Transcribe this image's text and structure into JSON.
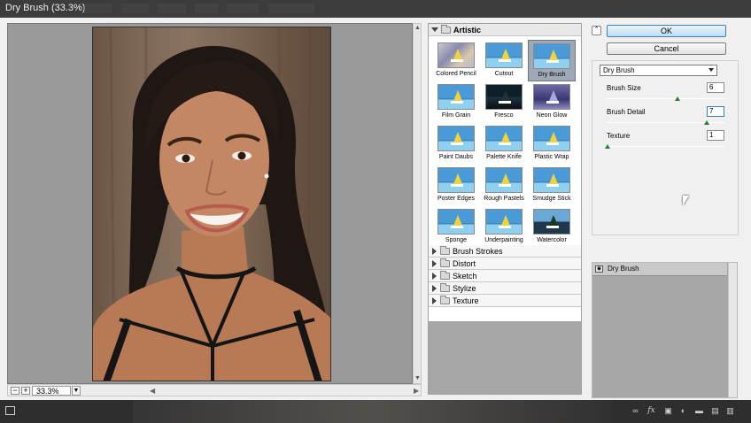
{
  "window": {
    "title": "Dry Brush (33.3%)"
  },
  "preview": {
    "zoom": "33.3%",
    "zoom_out": "−",
    "zoom_in": "+"
  },
  "gallery": {
    "open_category": "Artistic",
    "filters": [
      {
        "label": "Colored Pencil",
        "variant": "colored"
      },
      {
        "label": "Cutout",
        "variant": "cutout"
      },
      {
        "label": "Dry Brush",
        "variant": "dry",
        "selected": true
      },
      {
        "label": "Film Grain",
        "variant": "film"
      },
      {
        "label": "Fresco",
        "variant": "fresco"
      },
      {
        "label": "Neon Glow",
        "variant": "neon"
      },
      {
        "label": "Paint Daubs",
        "variant": "daubs"
      },
      {
        "label": "Palette Knife",
        "variant": "palette"
      },
      {
        "label": "Plastic Wrap",
        "variant": "plastic"
      },
      {
        "label": "Poster Edges",
        "variant": "poster"
      },
      {
        "label": "Rough Pastels",
        "variant": "rough"
      },
      {
        "label": "Smudge Stick",
        "variant": "smudge"
      },
      {
        "label": "Sponge",
        "variant": "sponge"
      },
      {
        "label": "Underpainting",
        "variant": "under"
      },
      {
        "label": "Watercolor",
        "variant": "water"
      }
    ],
    "categories": [
      "Brush Strokes",
      "Distort",
      "Sketch",
      "Stylize",
      "Texture"
    ]
  },
  "buttons": {
    "ok": "OK",
    "cancel": "Cancel"
  },
  "settings": {
    "filter": "Dry Brush",
    "params": [
      {
        "label": "Brush Size",
        "value": "6",
        "slider": 0.6
      },
      {
        "label": "Brush Detail",
        "value": "7",
        "slider": 0.7
      },
      {
        "label": "Texture",
        "value": "1",
        "slider": 0.0
      }
    ]
  },
  "layers": {
    "items": [
      "Dry Brush"
    ]
  },
  "icons": {
    "collapse": "double-chevron-up-icon",
    "eye": "eye-icon",
    "new_layer": "new-layer-icon",
    "delete": "trash-icon"
  },
  "colors": {
    "ok_accent": "#3c7fb1",
    "slider_thumb": "#2a7a3a",
    "selected_thumb": "#9ea8b6"
  },
  "taskbar": {
    "fx": "fx"
  }
}
